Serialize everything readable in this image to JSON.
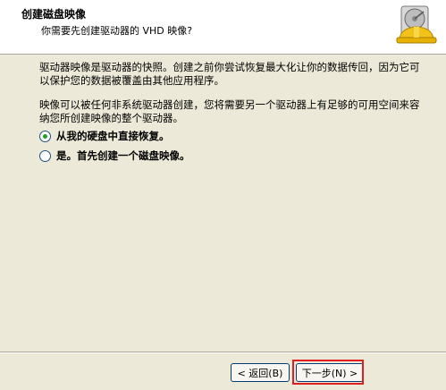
{
  "header": {
    "title": "创建磁盘映像",
    "subtitle": "你需要先创建驱动器的 VHD 映像?"
  },
  "body": {
    "paragraph1": "驱动器映像是驱动器的快照。创建之前你尝试恢复最大化让你的数据传回，因为它可以保护您的数据被覆盖由其他应用程序。",
    "paragraph2": "映像可以被任何非系统驱动器创建，您将需要另一个驱动器上有足够的可用空间来容纳您所创建映像的整个驱动器。"
  },
  "options": [
    {
      "label": "从我的硬盘中直接恢复。",
      "selected": true
    },
    {
      "label": "是。首先创建一个磁盘映像。",
      "selected": false
    }
  ],
  "buttons": {
    "back": "< 返回(B)",
    "next": "下一步(N) >"
  },
  "colors": {
    "dialog_bg": "#ece9d8",
    "header_bg": "#ffffff",
    "highlight": "#e02020",
    "radio_selected": "#21a121"
  },
  "icons": {
    "header": "disk-repair-helmet-icon"
  }
}
